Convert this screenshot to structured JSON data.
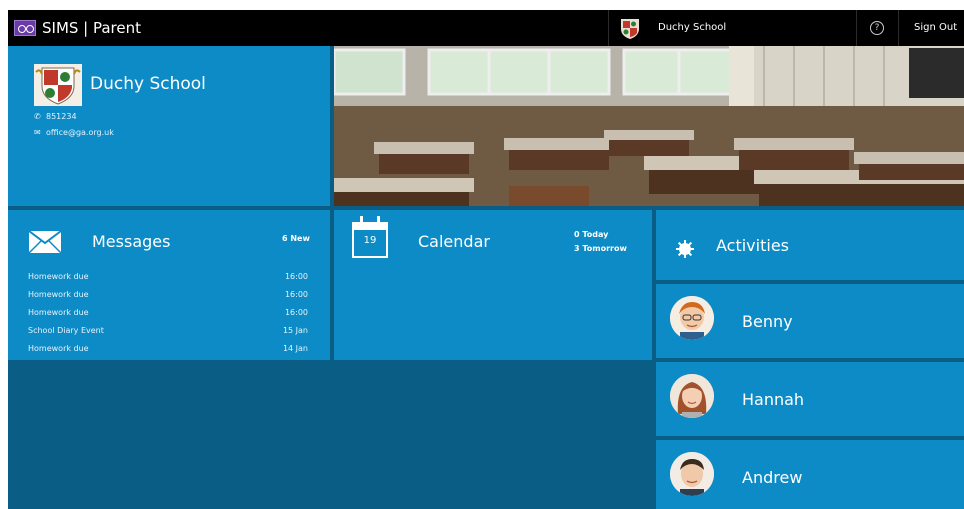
{
  "app": {
    "title": "SIMS | Parent"
  },
  "topbar": {
    "school": "Duchy School",
    "help_glyph": "?",
    "signout": "Sign Out"
  },
  "school_tile": {
    "name": "Duchy School",
    "phone": "851234",
    "email": "office@ga.org.uk"
  },
  "messages": {
    "title": "Messages",
    "new_count": "6 New",
    "items": [
      {
        "text": "Homework due",
        "when": "16:00"
      },
      {
        "text": "Homework due",
        "when": "16:00"
      },
      {
        "text": "Homework due",
        "when": "16:00"
      },
      {
        "text": "School Diary Event",
        "when": "15 Jan"
      },
      {
        "text": "Homework due",
        "when": "14 Jan"
      }
    ]
  },
  "calendar": {
    "title": "Calendar",
    "day": "19",
    "today": "0 Today",
    "tomorrow": "3 Tomorrow"
  },
  "activities": {
    "label": "Activities"
  },
  "children": [
    {
      "name": "Benny"
    },
    {
      "name": "Hannah"
    },
    {
      "name": "Andrew"
    }
  ],
  "colors": {
    "tile": "#0c8bc6",
    "background": "#0a5e85",
    "topbar": "#000000",
    "accent": "#6a3aa8"
  }
}
